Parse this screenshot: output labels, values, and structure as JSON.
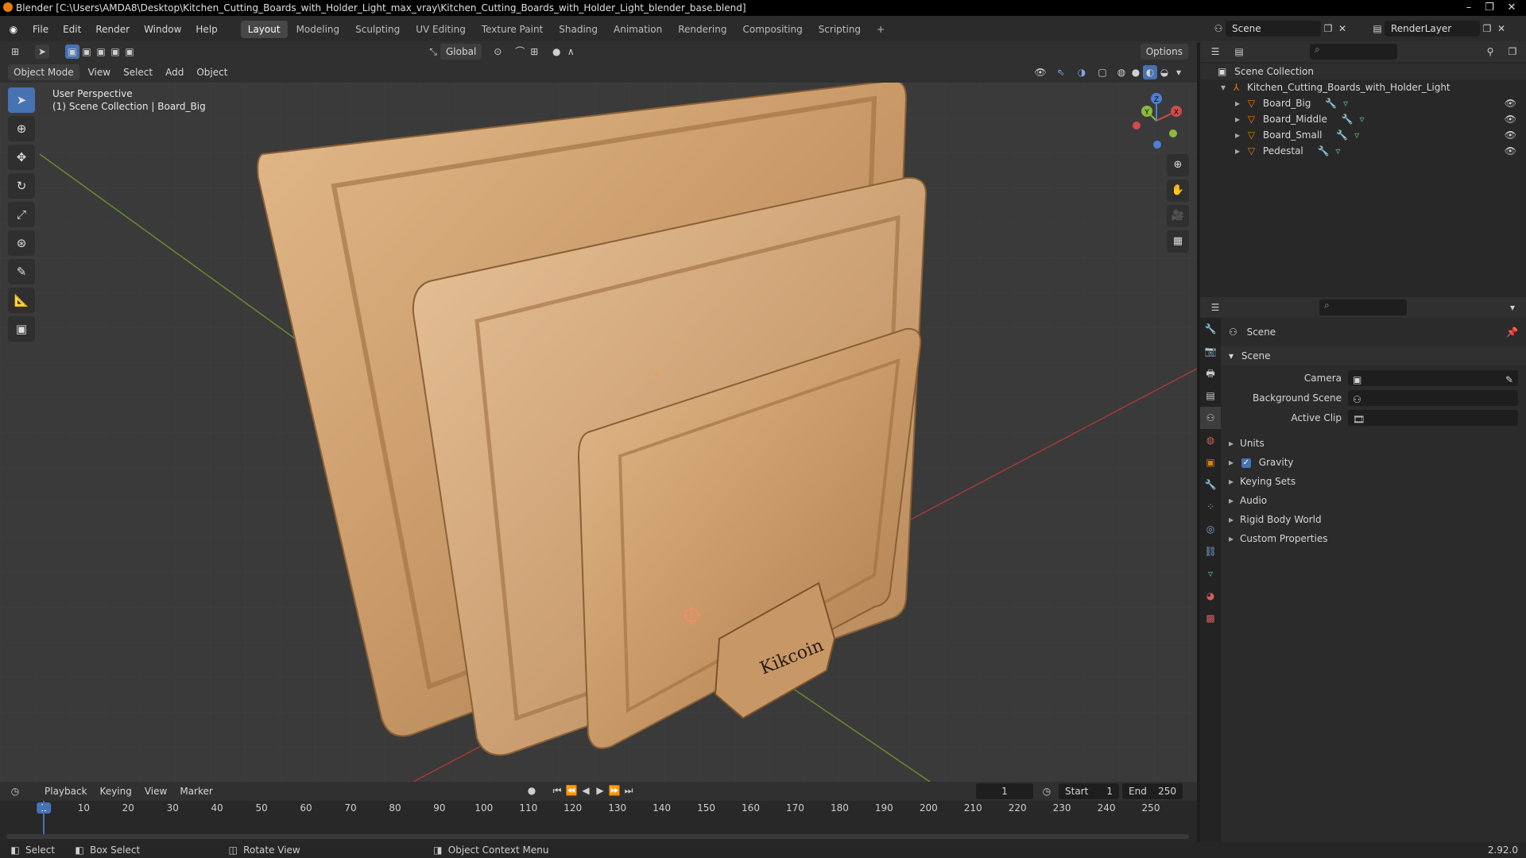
{
  "window": {
    "title": "Blender [C:\\Users\\AMDA8\\Desktop\\Kitchen_Cutting_Boards_with_Holder_Light_max_vray\\Kitchen_Cutting_Boards_with_Holder_Light_blender_base.blend]"
  },
  "menu": [
    "File",
    "Edit",
    "Render",
    "Window",
    "Help"
  ],
  "workspaces": [
    "Layout",
    "Modeling",
    "Sculpting",
    "UV Editing",
    "Texture Paint",
    "Shading",
    "Animation",
    "Rendering",
    "Compositing",
    "Scripting"
  ],
  "topright": {
    "scene": "Scene",
    "render_layer": "RenderLayer"
  },
  "viewport": {
    "transform_orientation": "Global",
    "options_label": "Options",
    "mode": "Object Mode",
    "menus": [
      "View",
      "Select",
      "Add",
      "Object"
    ],
    "info_line1": "User Perspective",
    "info_line2": "(1) Scene Collection | Board_Big",
    "gizmo": {
      "x": "X",
      "y": "Y",
      "z": "Z"
    },
    "logo_text": "Kikcoin"
  },
  "outliner": {
    "root": "Scene Collection",
    "collection": "Kitchen_Cutting_Boards_with_Holder_Light",
    "objects": [
      "Board_Big",
      "Board_Middle",
      "Board_Small",
      "Pedestal"
    ]
  },
  "properties": {
    "context": "Scene",
    "panel": "Scene",
    "camera_label": "Camera",
    "bgscene_label": "Background Scene",
    "clip_label": "Active Clip",
    "subpanels": [
      "Units",
      "Gravity",
      "Keying Sets",
      "Audio",
      "Rigid Body World",
      "Custom Properties"
    ]
  },
  "timeline": {
    "menus": [
      "Playback",
      "Keying",
      "View",
      "Marker"
    ],
    "current_frame": "1",
    "start_label": "Start",
    "start": "1",
    "end_label": "End",
    "end": "250",
    "ticks": [
      "1",
      "10",
      "20",
      "30",
      "40",
      "50",
      "60",
      "70",
      "80",
      "90",
      "100",
      "110",
      "120",
      "130",
      "140",
      "150",
      "160",
      "170",
      "180",
      "190",
      "200",
      "210",
      "220",
      "230",
      "240",
      "250"
    ]
  },
  "statusbar": {
    "select": "Select",
    "box_select": "Box Select",
    "rotate": "Rotate View",
    "context_menu": "Object Context Menu",
    "version": "2.92.0"
  }
}
